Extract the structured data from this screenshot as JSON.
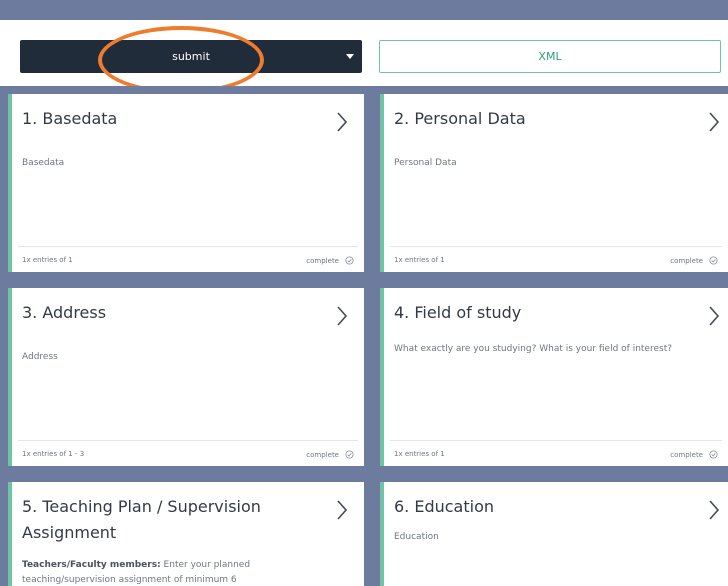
{
  "toolbar": {
    "submit_label": "submit",
    "xml_label": "XML"
  },
  "cards": [
    {
      "title": "1. Basedata",
      "description": "Basedata",
      "entries": "1x entries of 1",
      "status": "complete"
    },
    {
      "title": "2. Personal Data",
      "description": "Personal Data",
      "entries": "1x entries of 1",
      "status": "complete"
    },
    {
      "title": "3. Address",
      "description": "Address",
      "entries": "1x entries of 1 - 3",
      "status": "complete"
    },
    {
      "title": "4. Field of study",
      "description": "What exactly are you studying? What is your field of interest?",
      "entries": "1x entries of 1",
      "status": "complete"
    },
    {
      "title": "5. Teaching Plan / Supervision Assignment",
      "description_bold": "Teachers/Faculty members:",
      "description": " Enter your planned teaching/supervision assignment of minimum 6"
    },
    {
      "title": "6. Education",
      "description": "Education"
    }
  ],
  "colors": {
    "frame": "#6d7b9e",
    "submit_bg": "#212c3a",
    "accent": "#6ec3a8",
    "highlight": "#ee7c2f"
  },
  "icons": {
    "chevron": "chevron-right-icon",
    "check": "check-circle-icon",
    "caret": "caret-down-icon"
  }
}
